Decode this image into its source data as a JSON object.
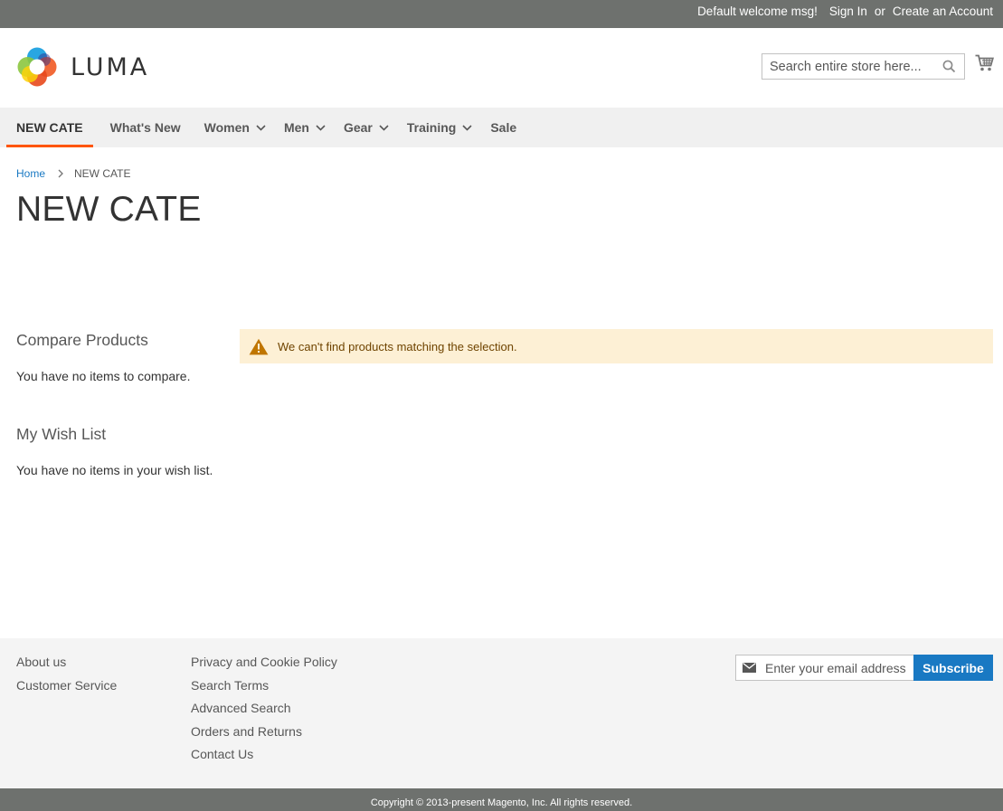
{
  "panel": {
    "welcome": "Default welcome msg!",
    "sign_in": "Sign In",
    "or": "or",
    "create_account": "Create an Account"
  },
  "header": {
    "logo_text": "LUMA",
    "search_placeholder": "Search entire store here...",
    "icons": {
      "search": "search-icon",
      "cart": "cart-icon"
    }
  },
  "nav": {
    "items": [
      {
        "label": "NEW CATE",
        "active": true,
        "has_dropdown": false
      },
      {
        "label": "What's New",
        "has_dropdown": false
      },
      {
        "label": "Women",
        "has_dropdown": true
      },
      {
        "label": "Men",
        "has_dropdown": true
      },
      {
        "label": "Gear",
        "has_dropdown": true
      },
      {
        "label": "Training",
        "has_dropdown": true
      },
      {
        "label": "Sale",
        "has_dropdown": false
      }
    ]
  },
  "breadcrumb": {
    "home": "Home",
    "current": "NEW CATE"
  },
  "page_title": "NEW CATE",
  "sidebar": {
    "compare": {
      "title": "Compare Products",
      "empty": "You have no items to compare."
    },
    "wishlist": {
      "title": "My Wish List",
      "empty": "You have no items in your wish list."
    }
  },
  "message": {
    "text": "We can't find products matching the selection.",
    "icon": "warning-icon"
  },
  "footer": {
    "col1": [
      "About us",
      "Customer Service"
    ],
    "col2": [
      "Privacy and Cookie Policy",
      "Search Terms",
      "Advanced Search",
      "Orders and Returns",
      "Contact Us"
    ],
    "newsletter": {
      "placeholder": "Enter your email address",
      "button": "Subscribe",
      "icon": "envelope-icon"
    }
  },
  "copyright": "Copyright © 2013-present Magento, Inc. All rights reserved.",
  "colors": {
    "panel_bg": "#6e716e",
    "nav_bg": "#f0f0f0",
    "accent": "#ff5501",
    "link": "#1979c3",
    "message_bg": "#fdf0d5",
    "message_text": "#6f4400",
    "footer_bg": "#f4f4f4"
  }
}
